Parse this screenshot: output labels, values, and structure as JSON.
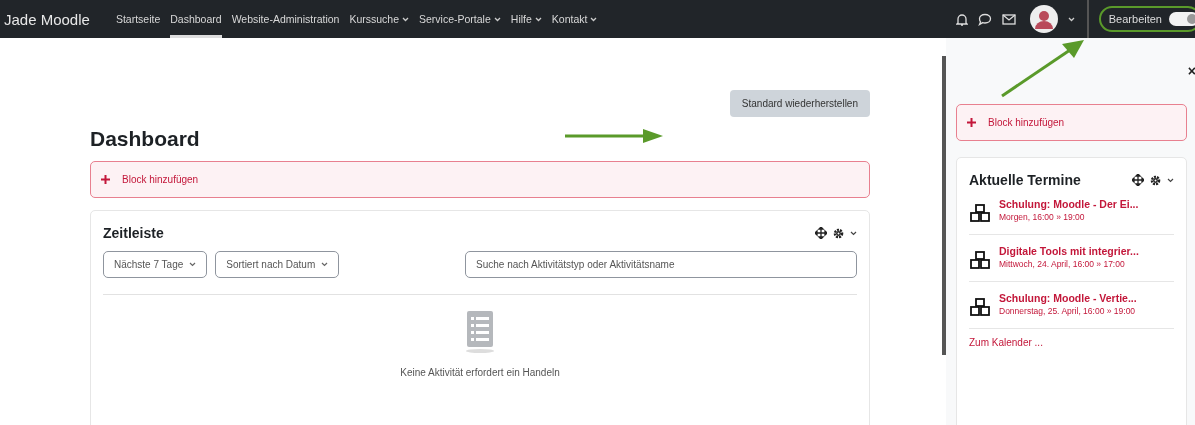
{
  "navbar": {
    "brand": "Jade Moodle",
    "items": [
      {
        "label": "Startseite",
        "selected": false,
        "dropdown": false
      },
      {
        "label": "Dashboard",
        "selected": true,
        "dropdown": false
      },
      {
        "label": "Website-Administration",
        "selected": false,
        "dropdown": false
      },
      {
        "label": "Kurssuche",
        "selected": false,
        "dropdown": true
      },
      {
        "label": "Service-Portale",
        "selected": false,
        "dropdown": true
      },
      {
        "label": "Hilfe",
        "selected": false,
        "dropdown": true
      },
      {
        "label": "Kontakt",
        "selected": false,
        "dropdown": true
      }
    ],
    "edit_mode": {
      "label": "Bearbeiten",
      "on": true
    }
  },
  "main": {
    "reset_button": "Standard wiederherstellen",
    "title": "Dashboard",
    "add_block": "Block hinzufügen",
    "timeline": {
      "title": "Zeitleiste",
      "filter": "Nächste 7 Tage",
      "sort": "Sortiert nach Datum",
      "search": {
        "placeholder": "Suche nach Aktivitätstyp oder Aktivitätsname"
      },
      "empty_message": "Keine Aktivität erfordert ein Handeln"
    }
  },
  "drawer": {
    "close": "×",
    "add_block": "Block hinzufügen",
    "events_block": {
      "title": "Aktuelle Termine",
      "events": [
        {
          "title": "Schulung: Moodle - Der Ei...",
          "date": "Morgen, 16:00 » 19:00"
        },
        {
          "title": "Digitale Tools mit integrier...",
          "date": "Mittwoch, 24. April, 16:00 » 17:00"
        },
        {
          "title": "Schulung: Moodle - Vertie...",
          "date": "Donnerstag, 25. April, 16:00 » 19:00"
        }
      ],
      "calendar_link": "Zum Kalender ..."
    }
  }
}
